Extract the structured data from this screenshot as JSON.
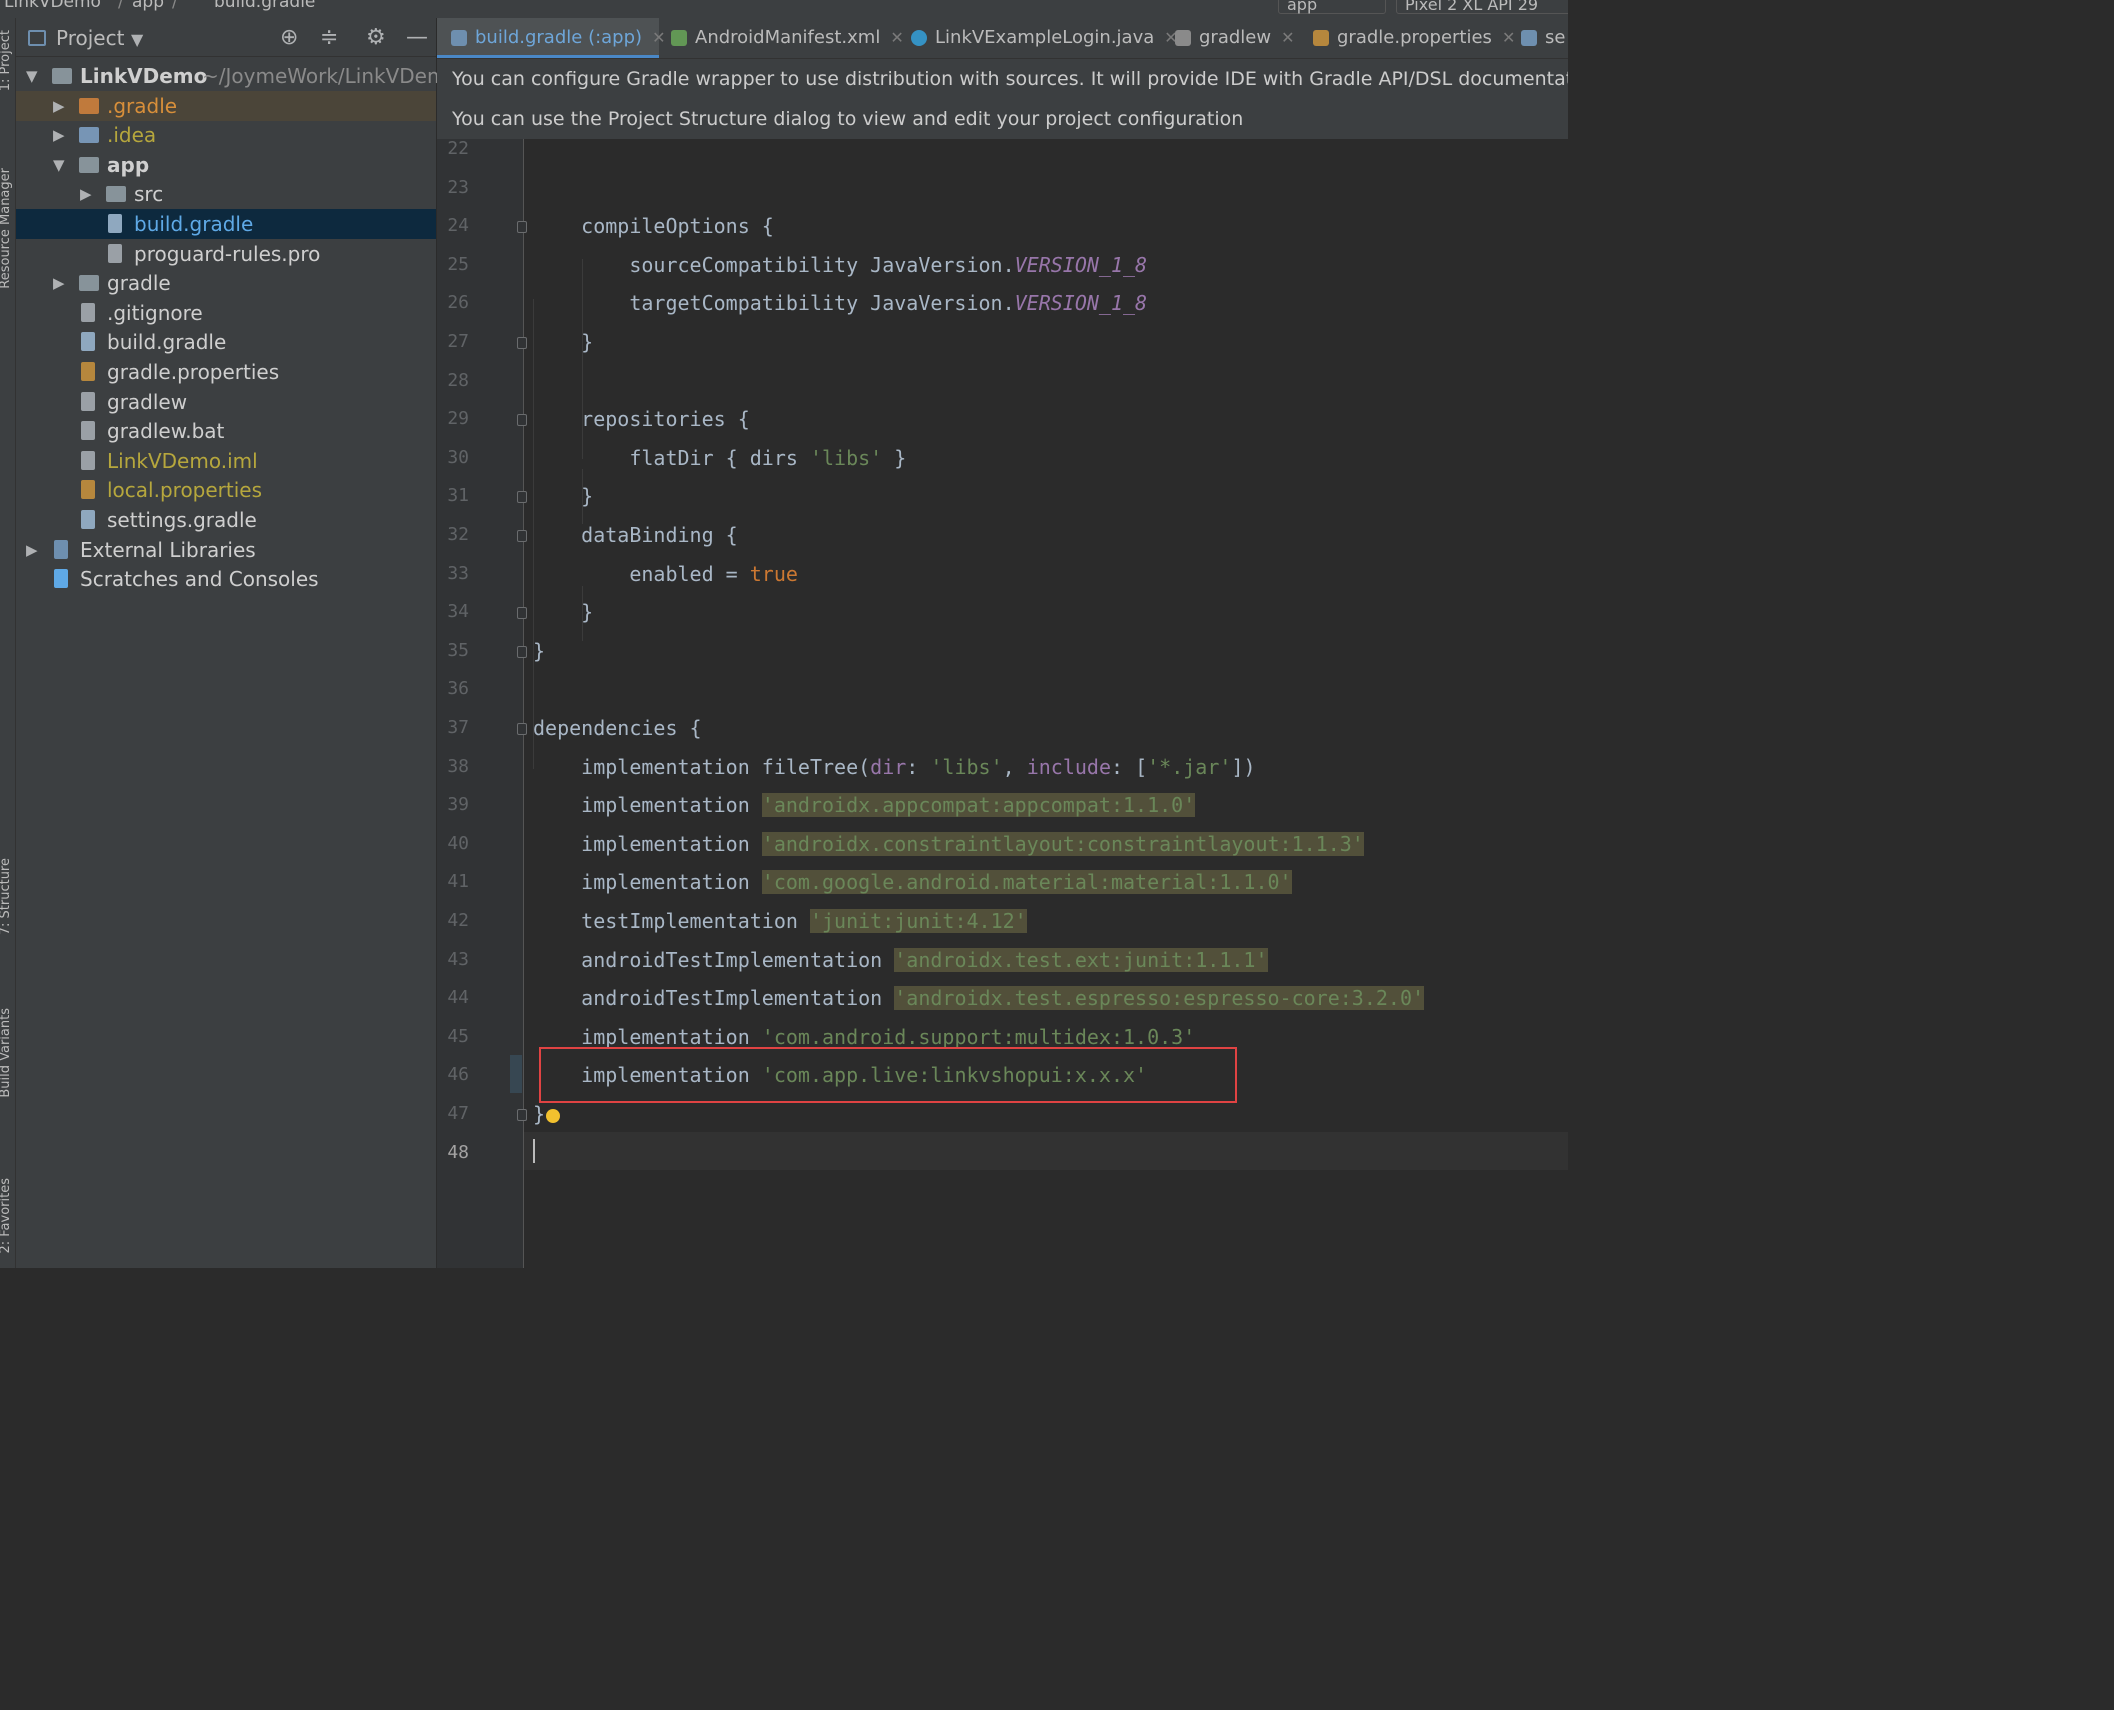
{
  "topbar": {
    "breadcrumb": [
      "LinkVDemo",
      "app",
      "build.gradle"
    ],
    "run_config": "app",
    "device": "Pixel 2 XL API 29"
  },
  "stripe": {
    "labels": [
      "1: Project",
      "Resource Manager",
      "7: Structure",
      "Build Variants",
      "2: Favorites"
    ]
  },
  "project_panel": {
    "title": "Project",
    "tree": [
      {
        "label": "LinkVDemo",
        "path": "~/JoymeWork/LinkVDemo",
        "depth": 0,
        "expanded": true,
        "icon": "module-folder-icon",
        "color": "#cfcfcf"
      },
      {
        "label": ".gradle",
        "depth": 1,
        "expanded": false,
        "icon": "folder-orange-icon",
        "color": "#d88f3a",
        "highlight": true
      },
      {
        "label": ".idea",
        "depth": 1,
        "expanded": false,
        "icon": "folder-icon",
        "color": "#b6a73d"
      },
      {
        "label": "app",
        "depth": 1,
        "expanded": true,
        "icon": "module-folder-icon",
        "color": "#cfcfcf"
      },
      {
        "label": "src",
        "depth": 2,
        "expanded": false,
        "icon": "folder-icon",
        "color": "#cfcfcf"
      },
      {
        "label": "build.gradle",
        "depth": 2,
        "icon": "gradle-icon",
        "color": "#5fa9e6",
        "selected": true
      },
      {
        "label": "proguard-rules.pro",
        "depth": 2,
        "icon": "text-file-icon",
        "color": "#cfcfcf"
      },
      {
        "label": "gradle",
        "depth": 1,
        "expanded": false,
        "icon": "folder-icon",
        "color": "#cfcfcf"
      },
      {
        "label": ".gitignore",
        "depth": 1,
        "icon": "ignore-file-icon",
        "color": "#cfcfcf"
      },
      {
        "label": "build.gradle",
        "depth": 1,
        "icon": "gradle-icon",
        "color": "#cfcfcf"
      },
      {
        "label": "gradle.properties",
        "depth": 1,
        "icon": "properties-icon",
        "color": "#cfcfcf"
      },
      {
        "label": "gradlew",
        "depth": 1,
        "icon": "shell-script-icon",
        "color": "#cfcfcf"
      },
      {
        "label": "gradlew.bat",
        "depth": 1,
        "icon": "text-file-icon",
        "color": "#cfcfcf"
      },
      {
        "label": "LinkVDemo.iml",
        "depth": 1,
        "icon": "iml-file-icon",
        "color": "#b6a73d"
      },
      {
        "label": "local.properties",
        "depth": 1,
        "icon": "properties-icon",
        "color": "#b6a73d"
      },
      {
        "label": "settings.gradle",
        "depth": 1,
        "icon": "gradle-icon",
        "color": "#cfcfcf"
      },
      {
        "label": "External Libraries",
        "depth": 0,
        "expanded": false,
        "icon": "library-icon",
        "color": "#cfcfcf"
      },
      {
        "label": "Scratches and Consoles",
        "depth": 0,
        "icon": "scratches-icon",
        "color": "#cfcfcf"
      }
    ]
  },
  "tabs": [
    {
      "label": "build.gradle (:app)",
      "icon": "gradle-icon",
      "active": true
    },
    {
      "label": "AndroidManifest.xml",
      "icon": "manifest-icon"
    },
    {
      "label": "LinkVExampleLogin.java",
      "icon": "java-class-icon"
    },
    {
      "label": "gradlew",
      "icon": "shell-script-icon"
    },
    {
      "label": "gradle.properties",
      "icon": "properties-icon"
    },
    {
      "label": "se",
      "icon": "gradle-icon"
    }
  ],
  "banners": [
    "You can configure Gradle wrapper to use distribution with sources. It will provide IDE with Gradle API/DSL documentatio",
    "You can use the Project Structure dialog to view and edit your project configuration"
  ],
  "editor": {
    "current_line": 48,
    "lines": [
      {
        "n": "22",
        "code": ""
      },
      {
        "n": "23",
        "code": ""
      },
      {
        "n": "24",
        "code": "    compileOptions {"
      },
      {
        "n": "25",
        "code": "        sourceCompatibility JavaVersion.VERSION_1_8"
      },
      {
        "n": "26",
        "code": "        targetCompatibility JavaVersion.VERSION_1_8"
      },
      {
        "n": "27",
        "code": "    }"
      },
      {
        "n": "28",
        "code": ""
      },
      {
        "n": "29",
        "code": "    repositories {"
      },
      {
        "n": "30",
        "code": "        flatDir { dirs 'libs' }"
      },
      {
        "n": "31",
        "code": "    }"
      },
      {
        "n": "32",
        "code": "    dataBinding {"
      },
      {
        "n": "33",
        "code": "        enabled = true"
      },
      {
        "n": "34",
        "code": "    }"
      },
      {
        "n": "35",
        "code": "}"
      },
      {
        "n": "36",
        "code": ""
      },
      {
        "n": "37",
        "code": "dependencies {"
      },
      {
        "n": "38",
        "code": "    implementation fileTree(dir: 'libs', include: ['*.jar'])"
      },
      {
        "n": "39",
        "code": "    implementation 'androidx.appcompat:appcompat:1.1.0'"
      },
      {
        "n": "40",
        "code": "    implementation 'androidx.constraintlayout:constraintlayout:1.1.3'"
      },
      {
        "n": "41",
        "code": "    implementation 'com.google.android.material:material:1.1.0'"
      },
      {
        "n": "42",
        "code": "    testImplementation 'junit:junit:4.12'"
      },
      {
        "n": "43",
        "code": "    androidTestImplementation 'androidx.test.ext:junit:1.1.1'"
      },
      {
        "n": "44",
        "code": "    androidTestImplementation 'androidx.test.espresso:espresso-core:3.2.0'"
      },
      {
        "n": "45",
        "code": "    implementation 'com.android.support:multidex:1.0.3'"
      },
      {
        "n": "46",
        "code": "    implementation 'com.app.live:linkvshopui:x.x.x'"
      },
      {
        "n": "47",
        "code": "}"
      },
      {
        "n": "48",
        "code": ""
      }
    ]
  },
  "colors": {
    "editor_bg": "#2b2b2b",
    "panel_bg": "#3c3f41",
    "selection": "#0d293e",
    "keyword": "#cc7832",
    "string": "#6a8759",
    "field": "#9876aa",
    "highlight_box": "#e04343"
  }
}
